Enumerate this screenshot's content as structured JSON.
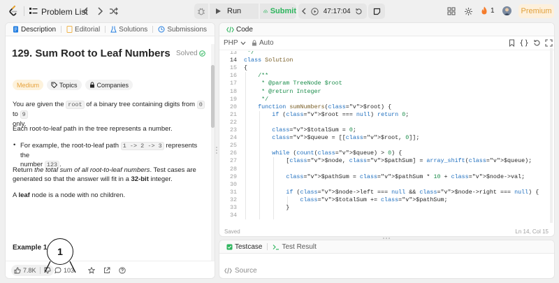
{
  "topbar": {
    "problem_list_label": "Problem List",
    "run_label": "Run",
    "submit_label": "Submit",
    "timer": "47:17:04",
    "streak_count": "1",
    "premium_label": "Premium"
  },
  "left_tabs": [
    {
      "label": "Description"
    },
    {
      "label": "Editorial"
    },
    {
      "label": "Solutions"
    },
    {
      "label": "Submissions"
    }
  ],
  "problem": {
    "title": "129. Sum Root to Leaf Numbers",
    "solved_label": "Solved",
    "difficulty": "Medium",
    "topics_label": "Topics",
    "companies_label": "Companies",
    "p1_a": "You are given the ",
    "p1_code1": "root",
    "p1_b": " of a binary tree containing digits from ",
    "p1_code2": "0",
    "p1_c": " to ",
    "p1_code3": "9",
    "p1_d": "only.",
    "p2": "Each root-to-leaf path in the tree represents a number.",
    "bullet_a": "For example, the root-to-leaf path ",
    "bullet_code1": "1 -> 2 -> 3",
    "bullet_b": " represents the",
    "bullet_c": "number ",
    "bullet_code2": "123",
    "bullet_d": ".",
    "p3_a": "Return ",
    "p3_em": "the total sum of all root-to-leaf numbers",
    "p3_b": ". Test cases are",
    "p3_c": "generated so that the answer will fit in a ",
    "p3_strong": "32-bit",
    "p3_d": " integer.",
    "p4_a": "A ",
    "p4_strong": "leaf",
    "p4_b": " node is a node with no children.",
    "example_label": "Example 1:"
  },
  "callout_label": "1",
  "bottom_bar": {
    "likes": "7.8K",
    "comments": "103"
  },
  "code_panel": {
    "tab_label": "Code",
    "language": "PHP",
    "auto_label": "Auto",
    "saved_label": "Saved",
    "cursor_pos": "Ln 14, Col 15",
    "lines": [
      {
        "n": "13",
        "t": " */"
      },
      {
        "n": "14",
        "t": "class Solution"
      },
      {
        "n": "15",
        "t": "{"
      },
      {
        "n": "16",
        "t": "    /**"
      },
      {
        "n": "17",
        "t": "     * @param TreeNode $root"
      },
      {
        "n": "18",
        "t": "     * @return Integer"
      },
      {
        "n": "19",
        "t": "     */"
      },
      {
        "n": "20",
        "t": "    function sumNumbers($root) {"
      },
      {
        "n": "21",
        "t": "        if ($root === null) return 0;"
      },
      {
        "n": "22",
        "t": ""
      },
      {
        "n": "23",
        "t": "        $totalSum = 0;"
      },
      {
        "n": "24",
        "t": "        $queue = [[$root, 0]];"
      },
      {
        "n": "25",
        "t": ""
      },
      {
        "n": "26",
        "t": "        while (count($queue) > 0) {"
      },
      {
        "n": "27",
        "t": "            [$node, $pathSum] = array_shift($queue);"
      },
      {
        "n": "28",
        "t": ""
      },
      {
        "n": "29",
        "t": "            $pathSum = $pathSum * 10 + $node->val;"
      },
      {
        "n": "30",
        "t": ""
      },
      {
        "n": "31",
        "t": "            if ($node->left === null && $node->right === null) {"
      },
      {
        "n": "32",
        "t": "                $totalSum += $pathSum;"
      },
      {
        "n": "33",
        "t": "            }"
      },
      {
        "n": "34",
        "t": ""
      }
    ]
  },
  "test_panel": {
    "testcase_label": "Testcase",
    "result_label": "Test Result",
    "source_label": "Source"
  },
  "colors": {
    "accent_green": "#2db55d",
    "medium": "#e6a23c",
    "premium": "#e0a03a"
  }
}
